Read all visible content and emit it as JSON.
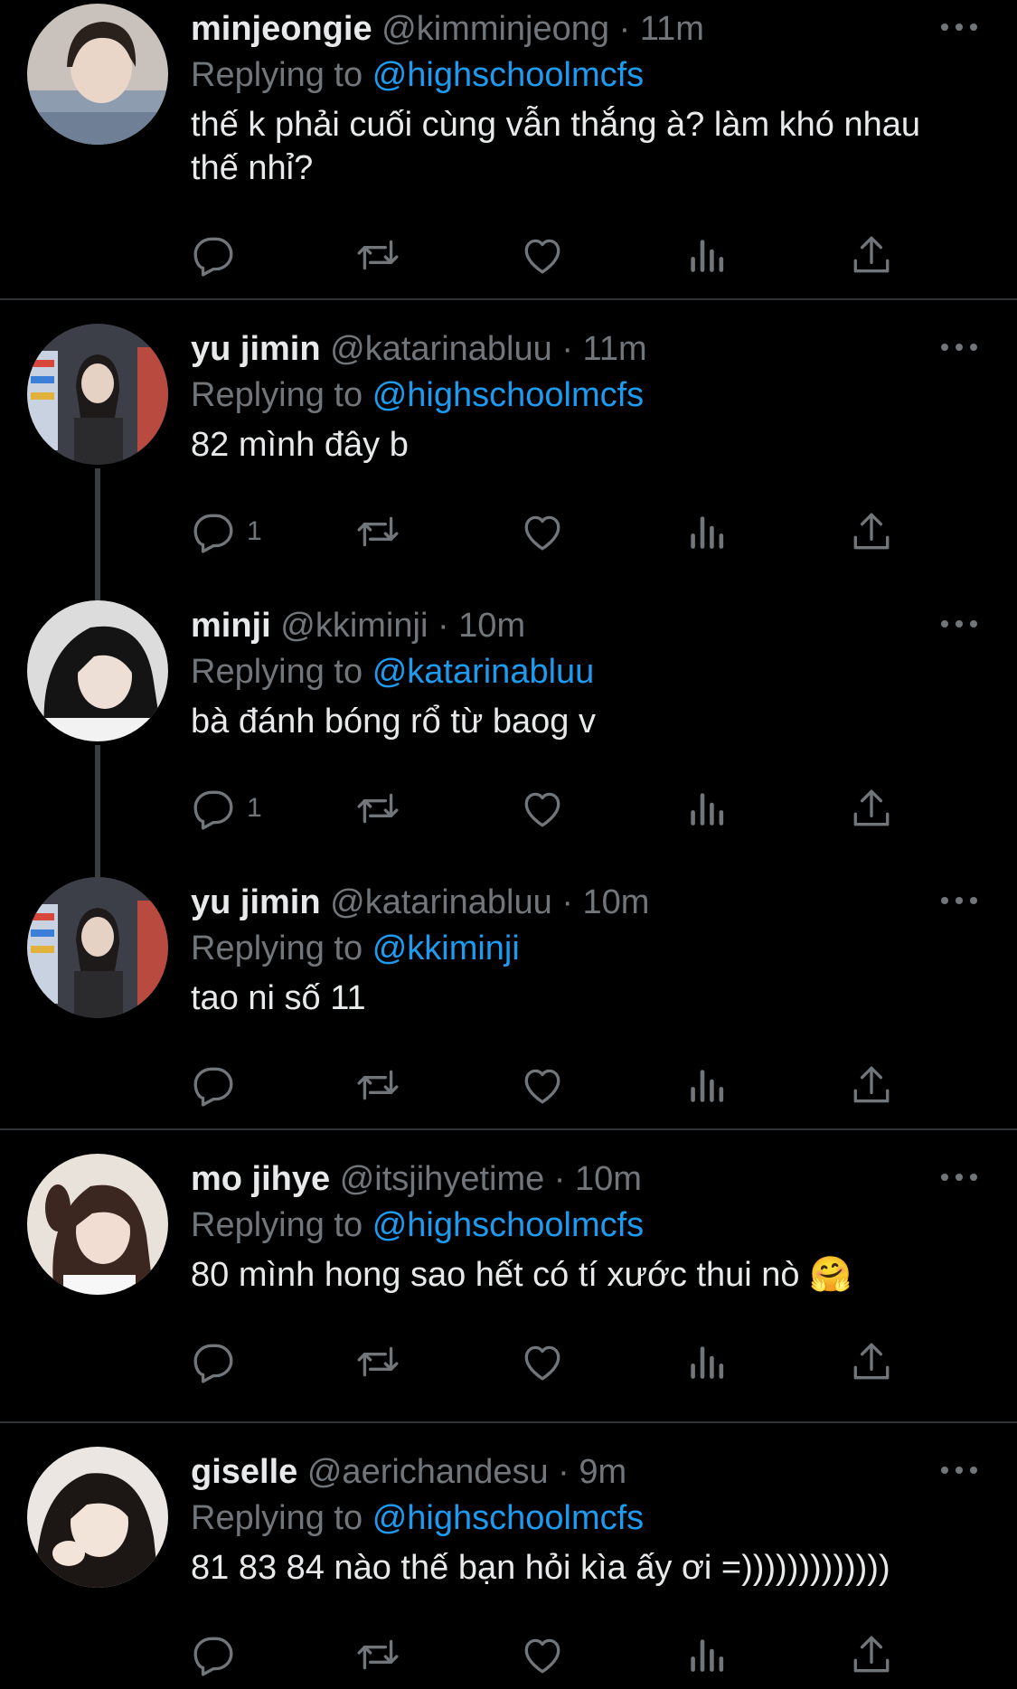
{
  "tweets": [
    {
      "display_name": "minjeongie",
      "handle": "@kimminjeong",
      "time": "11m",
      "replying_label": "Replying to",
      "replying_to": "@highschoolmcfs",
      "text": "thế k phải cuối cùng vẫn thắng à? làm khó nhau thế nhỉ?",
      "reply_count": "",
      "avatar_icon": "profile-photo"
    },
    {
      "display_name": "yu jimin",
      "handle": "@katarinabluu",
      "time": "11m",
      "replying_label": "Replying to",
      "replying_to": "@highschoolmcfs",
      "text": "82 mình đây b",
      "reply_count": "1",
      "avatar_icon": "profile-photo"
    },
    {
      "display_name": "minji",
      "handle": "@kkiminji",
      "time": "10m",
      "replying_label": "Replying to",
      "replying_to": "@katarinabluu",
      "text": "bà đánh bóng rổ từ baog v",
      "reply_count": "1",
      "avatar_icon": "profile-photo"
    },
    {
      "display_name": "yu jimin",
      "handle": "@katarinabluu",
      "time": "10m",
      "replying_label": "Replying to",
      "replying_to": "@kkiminji",
      "text": "tao ni số 11",
      "reply_count": "",
      "avatar_icon": "profile-photo"
    },
    {
      "display_name": "mo jihye",
      "handle": "@itsjihyetime",
      "time": "10m",
      "replying_label": "Replying to",
      "replying_to": "@highschoolmcfs",
      "text": "80 mình hong sao hết có tí xước thui nò 🤗",
      "reply_count": "",
      "avatar_icon": "profile-photo"
    },
    {
      "display_name": "giselle",
      "handle": "@aerichandesu",
      "time": "9m",
      "replying_label": "Replying to",
      "replying_to": "@highschoolmcfs",
      "text": "81 83 84 nào thế bạn hỏi kìa ấy ơi =)))))))))))))",
      "reply_count": "",
      "avatar_icon": "profile-photo"
    }
  ],
  "separator": "·",
  "action_icons": [
    "reply-icon",
    "retweet-icon",
    "like-icon",
    "views-icon",
    "share-icon"
  ],
  "colors": {
    "background": "#000000",
    "text": "#e7e9ea",
    "muted": "#71767b",
    "accent": "#1d9bf0",
    "divider": "#2f3336"
  }
}
